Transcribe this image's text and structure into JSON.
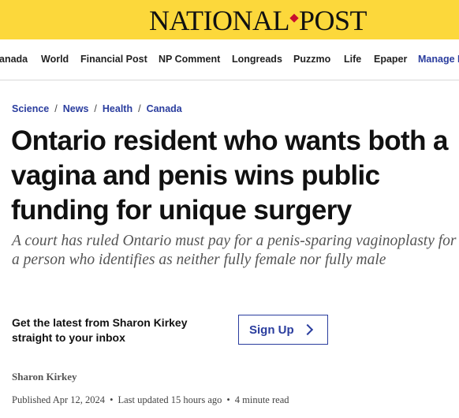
{
  "masthead": {
    "logo_left": "NATIONAL",
    "logo_right": "POST",
    "brand_color": "#fcd83b",
    "leaf_icon": "maple-leaf-icon"
  },
  "nav": {
    "items": [
      "anada",
      "World",
      "Financial Post",
      "NP Comment",
      "Longreads",
      "Puzzmo",
      "Life",
      "Epaper",
      "Manage P"
    ]
  },
  "breadcrumb": {
    "items": [
      "Science",
      "News",
      "Health",
      "Canada"
    ],
    "separator": "/"
  },
  "article": {
    "headline": "Ontario resident who wants both a vagina and penis wins public funding for unique surgery",
    "dek": "A court has ruled Ontario must pay for a penis-sparing vaginoplasty for a person who identifies as neither fully female nor fully male",
    "author": "Sharon Kirkey",
    "published": "Published Apr 12, 2024",
    "updated": "Last updated 15 hours ago",
    "read_time": "4 minute read"
  },
  "newsletter": {
    "promo_line1": "Get the latest from Sharon Kirkey",
    "promo_line2": "straight to your inbox",
    "button_label": "Sign Up",
    "button_icon": "chevron-right-icon"
  },
  "colors": {
    "accent": "#2a3d9e",
    "masthead": "#fcd83b"
  }
}
